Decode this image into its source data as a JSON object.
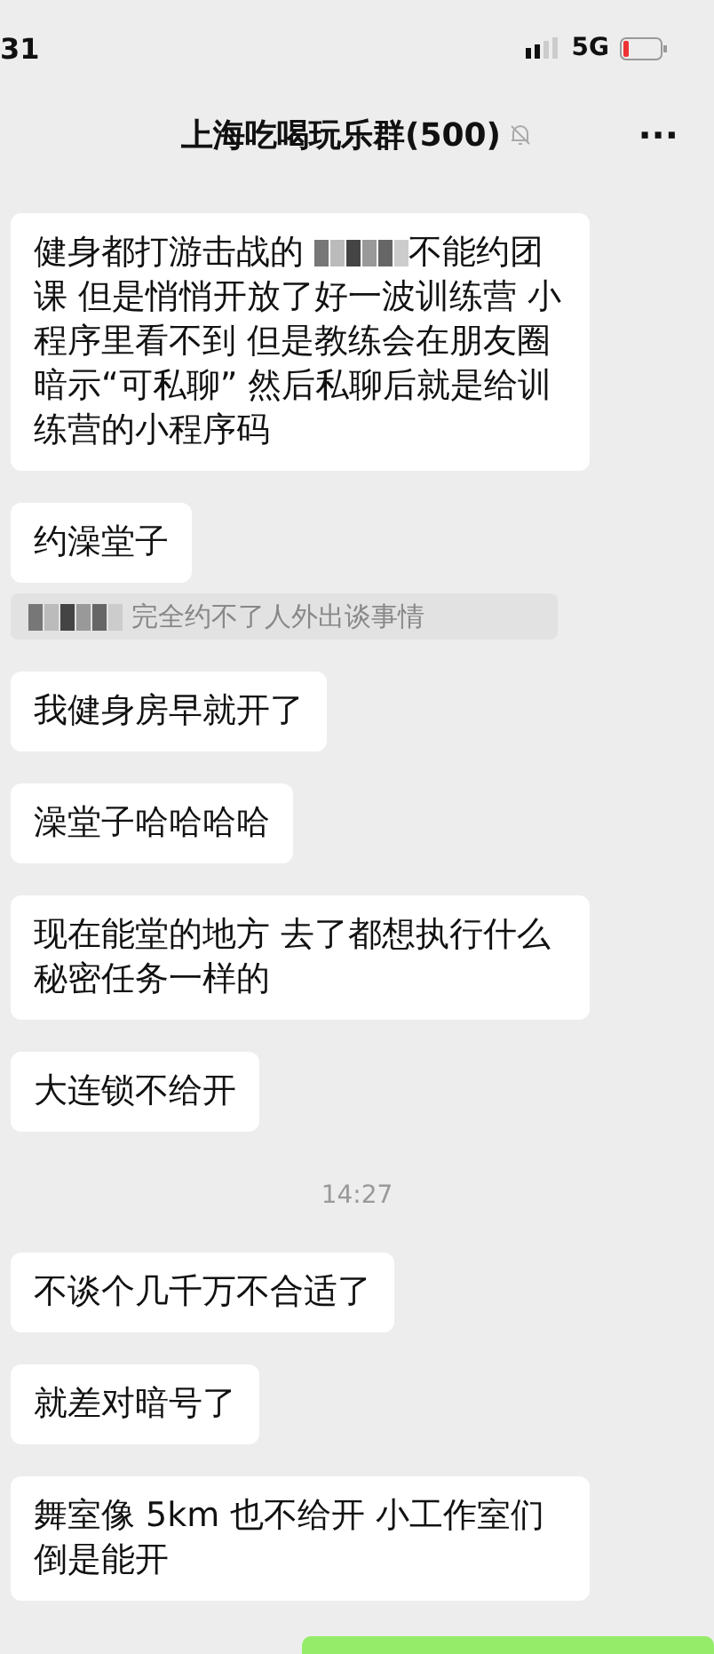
{
  "status_bar": {
    "time": "31",
    "network": "5G"
  },
  "header": {
    "title": "上海吃喝玩乐群(500)",
    "muted": true,
    "more": "···"
  },
  "messages": [
    {
      "kind": "bubble",
      "segments": [
        {
          "kind": "text",
          "text": "健身都打游击战的 "
        },
        {
          "kind": "mosaic"
        },
        {
          "kind": "text",
          "text": "不能约团课 但是悄悄开放了好一波训练营 小程序里看不到 但是教练会在朋友圈暗示“可私聊” 然后私聊后就是给训练营的小程序码"
        }
      ]
    },
    {
      "kind": "bubble",
      "segments": [
        {
          "kind": "text",
          "text": "约澡堂子"
        }
      ]
    },
    {
      "kind": "quote",
      "segments": [
        {
          "kind": "mosaic"
        },
        {
          "kind": "text",
          "text": " 完全约不了人外出谈事情"
        }
      ]
    },
    {
      "kind": "bubble",
      "segments": [
        {
          "kind": "text",
          "text": "我健身房早就开了"
        }
      ]
    },
    {
      "kind": "bubble",
      "segments": [
        {
          "kind": "text",
          "text": "澡堂子哈哈哈哈"
        }
      ]
    },
    {
      "kind": "bubble",
      "segments": [
        {
          "kind": "text",
          "text": "现在能堂的地方 去了都想执行什么秘密任务一样的"
        }
      ]
    },
    {
      "kind": "bubble",
      "segments": [
        {
          "kind": "text",
          "text": "大连锁不给开"
        }
      ]
    },
    {
      "kind": "time",
      "segments": [
        {
          "kind": "text",
          "text": "14:27"
        }
      ]
    },
    {
      "kind": "bubble",
      "segments": [
        {
          "kind": "text",
          "text": "不谈个几千万不合适了"
        }
      ]
    },
    {
      "kind": "bubble",
      "segments": [
        {
          "kind": "text",
          "text": "就差对暗号了"
        }
      ]
    },
    {
      "kind": "bubble",
      "segments": [
        {
          "kind": "text",
          "text": "舞室像 5km 也不给开 小工作室们倒是能开"
        }
      ]
    },
    {
      "kind": "own"
    }
  ]
}
